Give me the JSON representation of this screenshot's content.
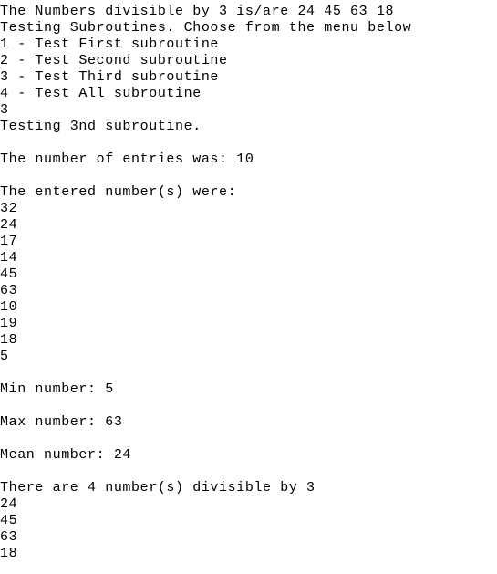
{
  "console": {
    "lines": [
      "The Numbers divisible by 3 is/are 24 45 63 18",
      "Testing Subroutines. Choose from the menu below",
      "1 - Test First subroutine",
      "2 - Test Second subroutine",
      "3 - Test Third subroutine",
      "4 - Test All subroutine",
      "3",
      "Testing 3nd subroutine.",
      "",
      "The number of entries was: 10",
      "",
      "The entered number(s) were:",
      "32",
      "24",
      "17",
      "14",
      "45",
      "63",
      "10",
      "19",
      "18",
      "5",
      "",
      "Min number: 5",
      "",
      "Max number: 63",
      "",
      "Mean number: 24",
      "",
      "There are 4 number(s) divisible by 3",
      "24",
      "45",
      "63",
      "18"
    ]
  }
}
